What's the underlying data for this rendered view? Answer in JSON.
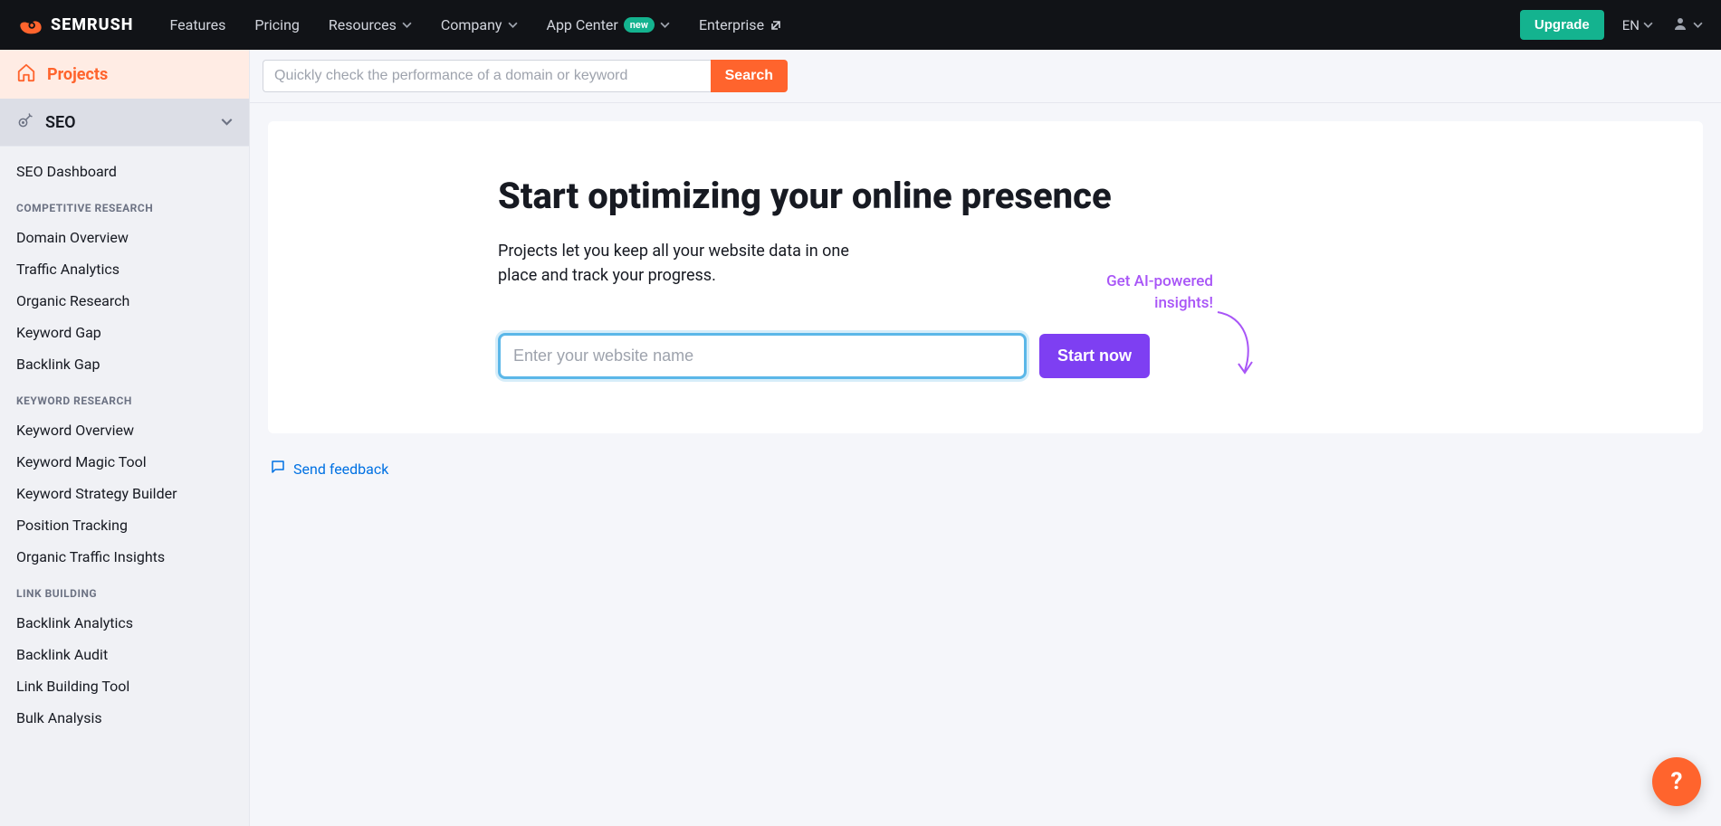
{
  "topnav": {
    "brand": "SEMRUSH",
    "links": {
      "features": "Features",
      "pricing": "Pricing",
      "resources": "Resources",
      "company": "Company",
      "appcenter": "App Center",
      "appcenter_badge": "new",
      "enterprise": "Enterprise"
    },
    "upgrade": "Upgrade",
    "lang": "EN"
  },
  "search": {
    "placeholder": "Quickly check the performance of a domain or keyword",
    "button": "Search"
  },
  "sidebar": {
    "primary": "Projects",
    "group": "SEO",
    "items1": [
      "SEO Dashboard"
    ],
    "heading1": "COMPETITIVE RESEARCH",
    "items2": [
      "Domain Overview",
      "Traffic Analytics",
      "Organic Research",
      "Keyword Gap",
      "Backlink Gap"
    ],
    "heading2": "KEYWORD RESEARCH",
    "items3": [
      "Keyword Overview",
      "Keyword Magic Tool",
      "Keyword Strategy Builder",
      "Position Tracking",
      "Organic Traffic Insights"
    ],
    "heading3": "LINK BUILDING",
    "items4": [
      "Backlink Analytics",
      "Backlink Audit",
      "Link Building Tool",
      "Bulk Analysis"
    ]
  },
  "hero": {
    "title": "Start optimizing your online presence",
    "subtitle": "Projects let you keep all your website data in one place and track your progress.",
    "ai_line1": "Get AI-powered",
    "ai_line2": "insights!",
    "input_placeholder": "Enter your website name",
    "start_btn": "Start now"
  },
  "feedback": "Send feedback",
  "fab": "?"
}
